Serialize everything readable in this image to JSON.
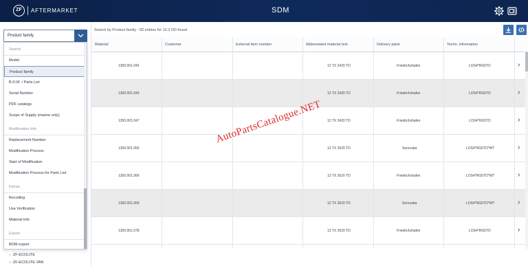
{
  "header": {
    "logo_text": "ZF",
    "brand": "AFTERMARKET",
    "title": "SDM",
    "icons": [
      "settings-icon",
      "catalog-switch-icon"
    ],
    "background_color": "#0e2a5a"
  },
  "left_panel": {
    "select": {
      "value": "Product family",
      "button_color": "#2f5e96"
    },
    "dropdown": {
      "items": [
        {
          "label": "Search",
          "type": "group"
        },
        {
          "label": "Model",
          "type": "option"
        },
        {
          "label": "Product family",
          "type": "option",
          "selected": true
        },
        {
          "label": "B.O.M. / Parts List",
          "type": "option"
        },
        {
          "label": "Serial Number",
          "type": "option"
        },
        {
          "label": "PDF catalogs",
          "type": "option"
        },
        {
          "label": "Scope of Supply (marine only)",
          "type": "option"
        },
        {
          "label": "Modification Info",
          "type": "group"
        },
        {
          "label": "Replacement Number",
          "type": "option"
        },
        {
          "label": "Modification Process",
          "type": "option"
        },
        {
          "label": "Start of Modification",
          "type": "option"
        },
        {
          "label": "Modification Process for Parts List",
          "type": "option"
        },
        {
          "label": "Extras",
          "type": "group"
        },
        {
          "label": "Recoding",
          "type": "option"
        },
        {
          "label": "Use Verification",
          "type": "option"
        },
        {
          "label": "Material info",
          "type": "option"
        },
        {
          "label": "Export",
          "type": "group"
        },
        {
          "label": "BOM export",
          "type": "option"
        }
      ]
    },
    "tree": [
      {
        "label": "ZF-ECOLITE"
      },
      {
        "label": "ZF-ECOLITE VAN"
      }
    ]
  },
  "main": {
    "search_info": "Search by Product family - 82 entries for 12.2 DD found",
    "actions": [
      "download-icon",
      "code-view-icon"
    ],
    "accent_color": "#3b6fb0",
    "columns": [
      "Material",
      "Customer",
      "External item number",
      "Abbreviated material text",
      "Delivery plant",
      "Techn. information"
    ],
    "rows": [
      {
        "material": "1350.001.042",
        "customer": "",
        "external": "",
        "abbrev": "12 TX 2420 TD",
        "plant": "Friedrichshafen",
        "techn": "LOS4*RG5TD"
      },
      {
        "material": "1350.001.043",
        "customer": "",
        "external": "",
        "abbrev": "12 TX 2420 TD",
        "plant": "Friedrichshafen",
        "techn": "LOS4*RG5TD"
      },
      {
        "material": "1350.001.047",
        "customer": "",
        "external": "",
        "abbrev": "12 TX 2420 TD",
        "plant": "Friedrichshafen",
        "techn": "LOS4*RG5TD"
      },
      {
        "material": "1350.001.056",
        "customer": "",
        "external": "",
        "abbrev": "12 TX 2620 TD",
        "plant": "Sorocaba",
        "techn": "LOS4*RG5TD*WT"
      },
      {
        "material": "1350.001.066",
        "customer": "",
        "external": "",
        "abbrev": "12 TX 2620 TD",
        "plant": "Friedrichshafen",
        "techn": "LOS4*RG5TD*WT"
      },
      {
        "material": "1350.001.069",
        "customer": "",
        "external": "",
        "abbrev": "12 TX 2620 TD",
        "plant": "Sorocaba",
        "techn": "LOS4*RG5TD*WT"
      },
      {
        "material": "1350.001.078",
        "customer": "",
        "external": "",
        "abbrev": "12 TX 2620 TD",
        "plant": "Friedrichshafen",
        "techn": "LOS4*RG5TD"
      }
    ]
  },
  "watermark": "AutoPartsCatalogue.NET"
}
